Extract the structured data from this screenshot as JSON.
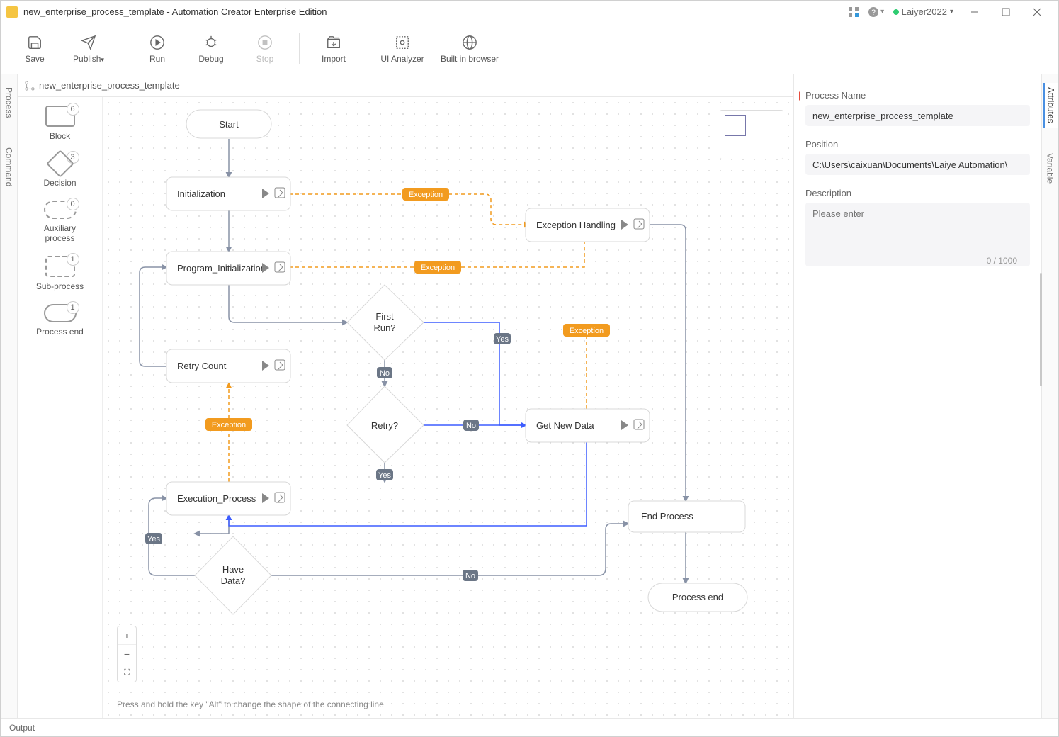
{
  "title": {
    "document": "new_enterprise_process_template",
    "app": "Automation Creator Enterprise Edition",
    "user": "Laiyer2022"
  },
  "toolbar": {
    "save": "Save",
    "publish": "Publish",
    "run": "Run",
    "debug": "Debug",
    "stop": "Stop",
    "import": "Import",
    "ui_analyzer": "UI Analyzer",
    "builtin_browser": "Built in browser"
  },
  "left_rail": {
    "process": "Process",
    "command": "Command"
  },
  "tab": {
    "label": "new_enterprise_process_template"
  },
  "palette": {
    "block": {
      "label": "Block",
      "count": "6"
    },
    "decision": {
      "label": "Decision",
      "count": "3"
    },
    "aux": {
      "label": "Auxiliary process",
      "count": "0"
    },
    "sub": {
      "label": "Sub-process",
      "count": "1"
    },
    "end": {
      "label": "Process end",
      "count": "1"
    }
  },
  "nodes": {
    "start": "Start",
    "init": "Initialization",
    "prog_init": "Program_Initialization",
    "first_run_a": "First",
    "first_run_b": "Run?",
    "retry_count": "Retry Count",
    "retry_q": "Retry?",
    "exec": "Execution_Process",
    "have_a": "Have",
    "have_b": "Data?",
    "exc_handle": "Exception Handling",
    "get_data": "Get New Data",
    "end_proc": "End Process",
    "proc_end": "Process end"
  },
  "edges": {
    "exception": "Exception",
    "yes": "Yes",
    "no": "No"
  },
  "hint": "Press and hold the key \"Alt\" to change the shape of the connecting line",
  "right_panel": {
    "process_name_label": "Process Name",
    "process_name_value": "new_enterprise_process_template",
    "position_label": "Position",
    "position_value": "C:\\Users\\caixuan\\Documents\\Laiye Automation\\",
    "description_label": "Description",
    "description_placeholder": "Please enter",
    "description_value": "",
    "counter": "0 / 1000"
  },
  "right_rail": {
    "attributes": "Attributes",
    "variable": "Variable"
  },
  "statusbar": {
    "output": "Output"
  }
}
